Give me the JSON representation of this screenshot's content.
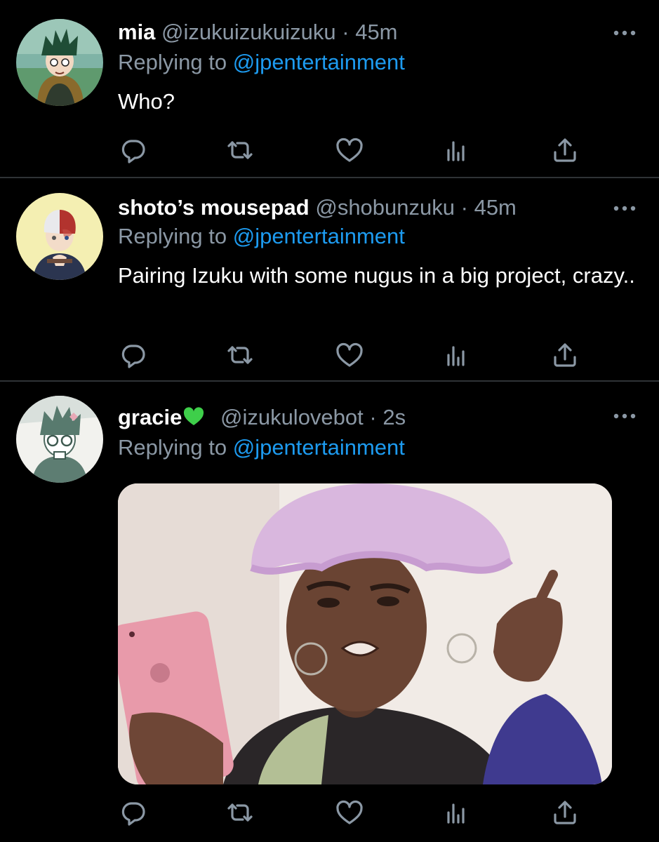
{
  "tweets": [
    {
      "name": "mia",
      "handle": "@izukuizukuizuku",
      "separator": "·",
      "time": "45m",
      "replying_prefix": "Replying to ",
      "replying_to": "@jpentertainment",
      "text": "Who?"
    },
    {
      "name": "shoto’s mousepad",
      "handle": "@shobunzuku",
      "separator": "·",
      "time": "45m",
      "replying_prefix": "Replying to ",
      "replying_to": "@jpentertainment",
      "text": "Pairing Izuku with some nugus in a big project, crazy.."
    },
    {
      "name": "gracie",
      "name_emoji": "green-heart-icon",
      "handle": "@izukulovebot",
      "separator": "·",
      "time": "2s",
      "replying_prefix": "Replying to ",
      "replying_to": "@jpentertainment",
      "media": "reaction-photo"
    }
  ],
  "icons": {
    "reply": "reply-icon",
    "retweet": "retweet-icon",
    "like": "heart-icon",
    "stats": "stats-icon",
    "share": "share-icon",
    "more": "more-options-icon"
  },
  "colors": {
    "background": "#000000",
    "text": "#ffffff",
    "secondary": "#8b98a5",
    "link": "#1d9bf0",
    "divider": "#2f3336",
    "green_heart": "#3ecf4a"
  }
}
